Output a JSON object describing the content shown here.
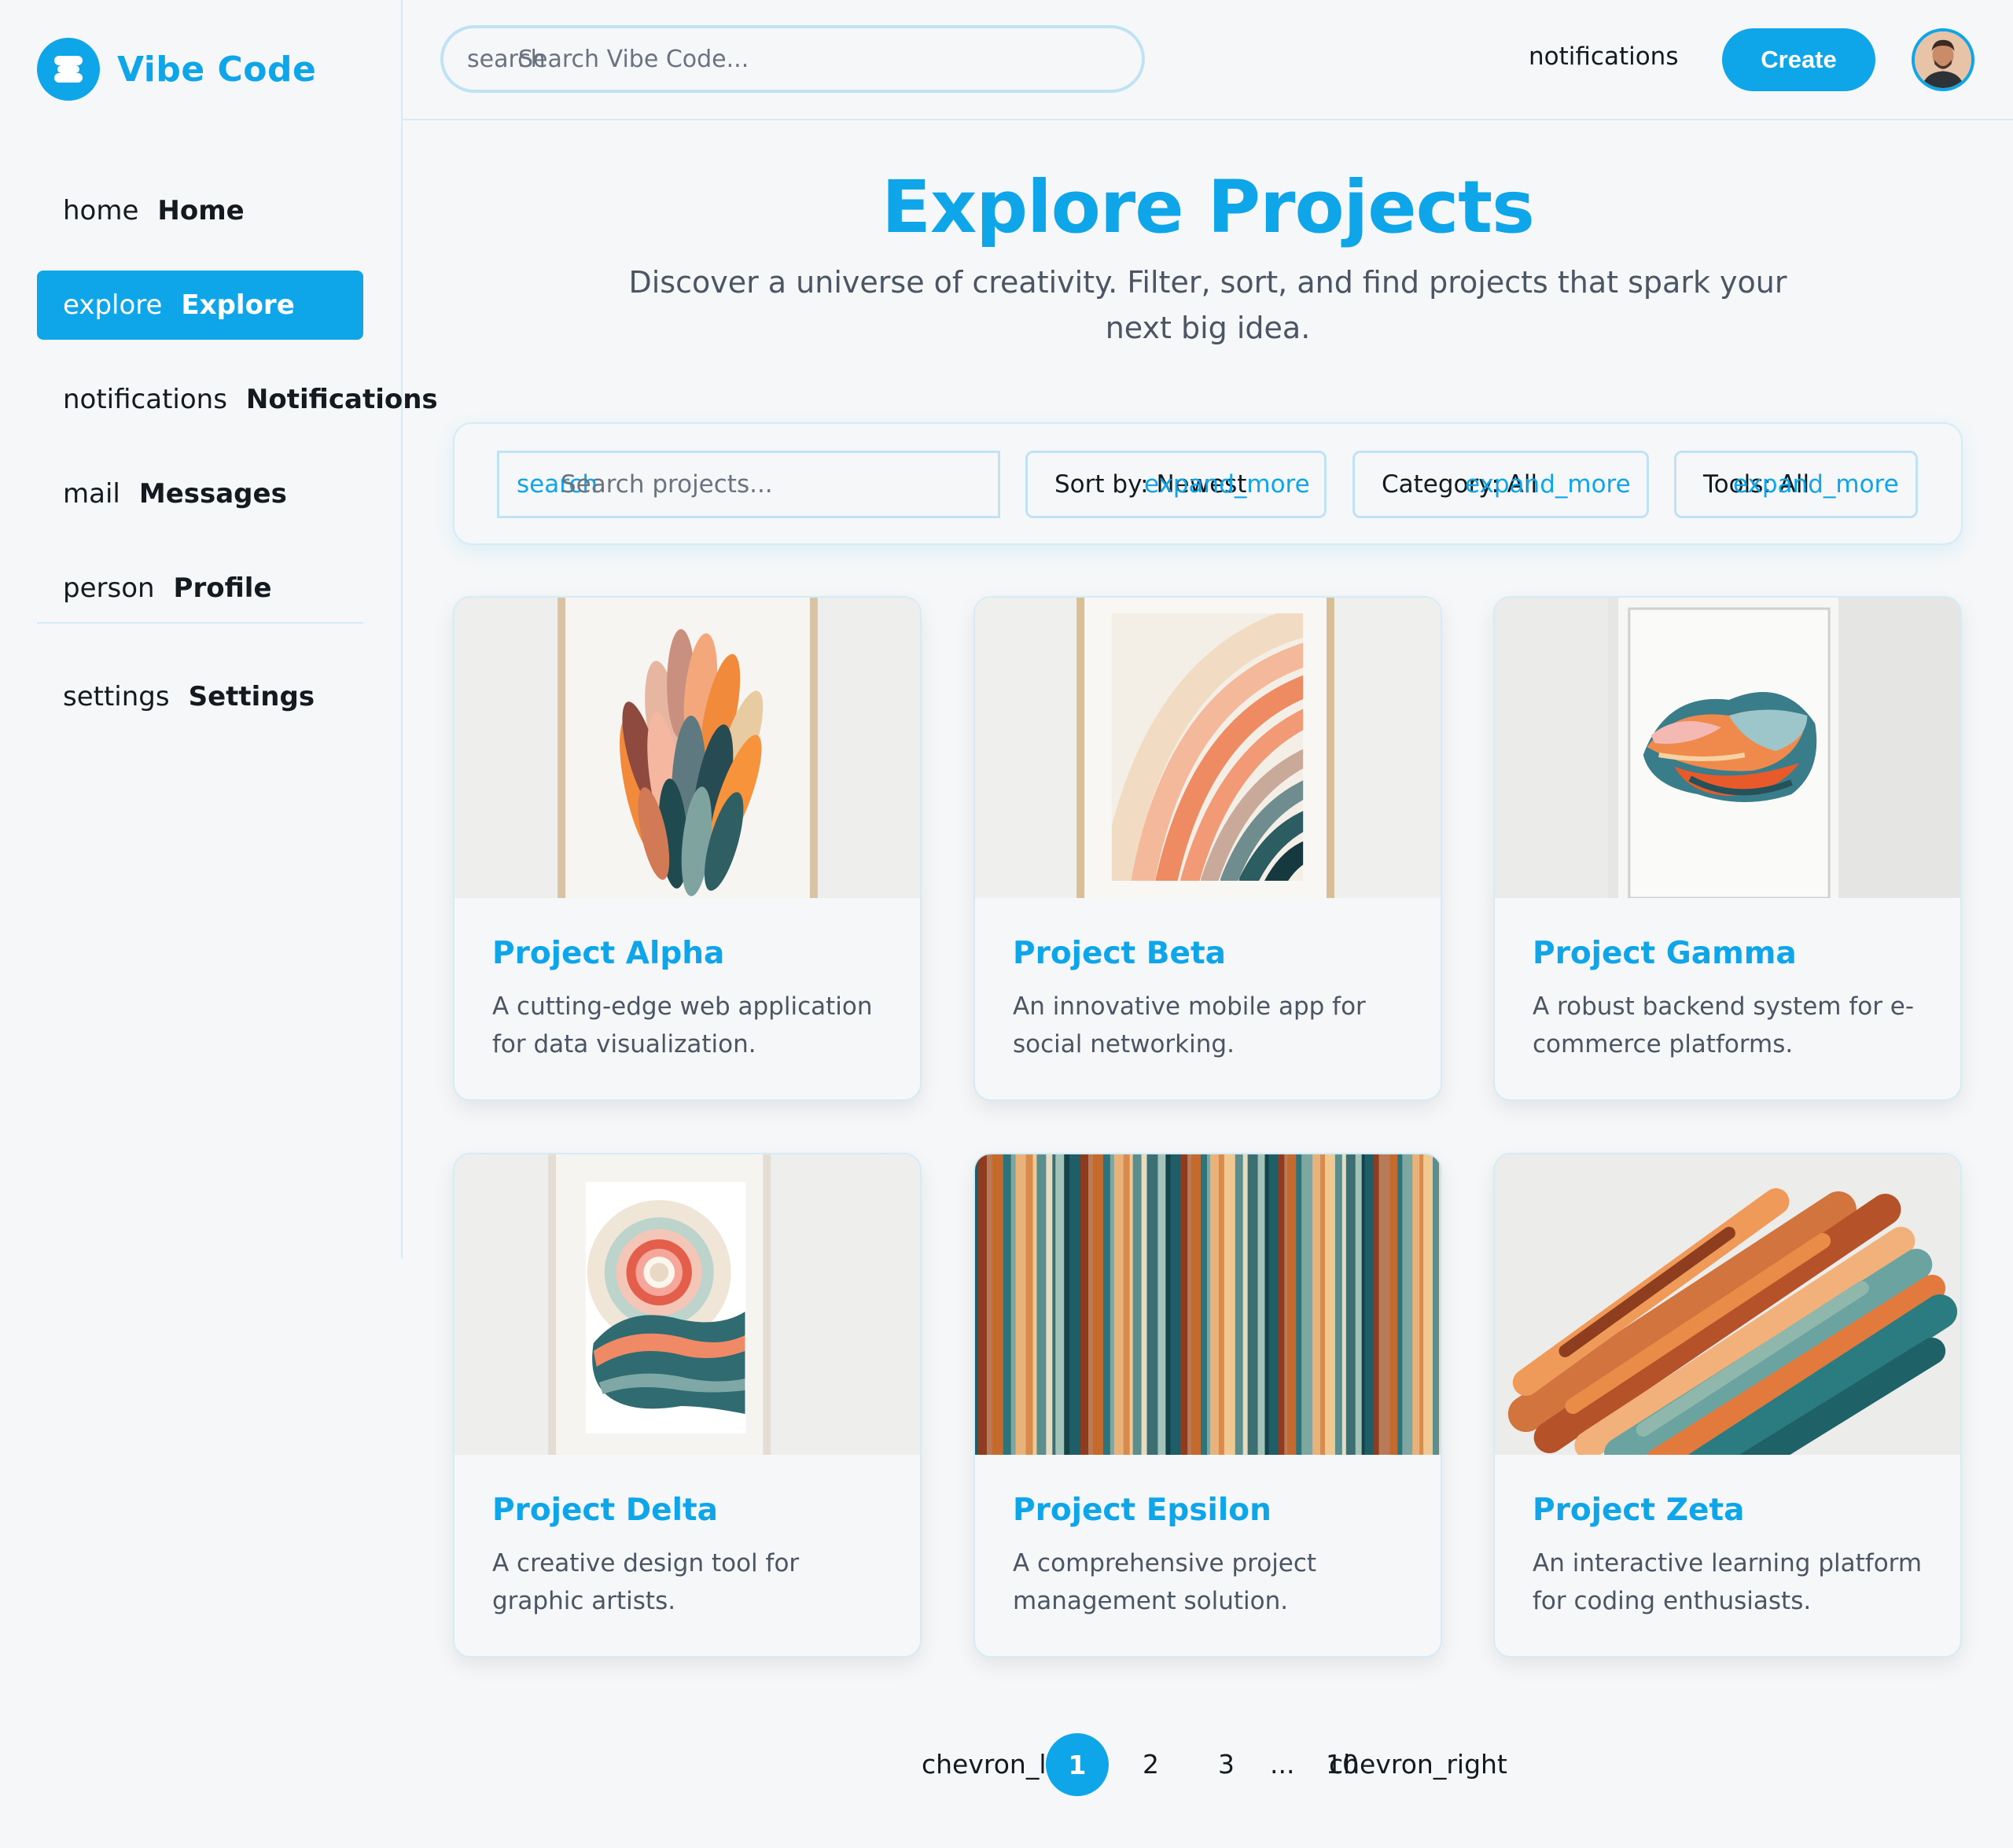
{
  "brand": {
    "name": "Vibe Code",
    "logo_icon": "layers-icon"
  },
  "colors": {
    "accent": "#0ea5e9",
    "border": "#d5ecf6",
    "background": "#f5f7f8",
    "text": "#141a1f",
    "muted": "#4b5563"
  },
  "sidebar": {
    "items": [
      {
        "icon": "home",
        "label": "Home"
      },
      {
        "icon": "explore",
        "label": "Explore",
        "active": true
      },
      {
        "icon": "notifications",
        "label": "Notifications"
      },
      {
        "icon": "mail",
        "label": "Messages"
      },
      {
        "icon": "person",
        "label": "Profile"
      },
      {
        "icon": "settings",
        "label": "Settings"
      }
    ]
  },
  "header": {
    "search_icon_text": "search",
    "search_placeholder": "Search Vibe Code...",
    "notifications_text": "notifications",
    "create_label": "Create"
  },
  "hero": {
    "title": "Explore Projects",
    "subtitle": "Discover a universe of creativity. Filter, sort, and find projects that spark your next big idea."
  },
  "filters": {
    "search_icon_text": "search",
    "search_placeholder": "Search projects...",
    "sort": {
      "value": "Sort by: Newest",
      "icon_text": "expand_more"
    },
    "category": {
      "value": "Category: All",
      "icon_text": "expand_more"
    },
    "tools": {
      "value": "Tools: All",
      "icon_text": "expand_more"
    }
  },
  "projects": [
    {
      "title": "Project Alpha",
      "description": "A cutting-edge web application for data visualization."
    },
    {
      "title": "Project Beta",
      "description": "An innovative mobile app for social networking."
    },
    {
      "title": "Project Gamma",
      "description": "A robust backend system for e-commerce platforms."
    },
    {
      "title": "Project Delta",
      "description": "A creative design tool for graphic artists."
    },
    {
      "title": "Project Epsilon",
      "description": "A comprehensive project management solution."
    },
    {
      "title": "Project Zeta",
      "description": "An interactive learning platform for coding enthusiasts."
    }
  ],
  "pagination": {
    "prev_text": "chevron_left",
    "pages": [
      "1",
      "2",
      "3"
    ],
    "ellipsis": "...",
    "last": "10",
    "next_text": "chevron_right",
    "current": "1"
  }
}
